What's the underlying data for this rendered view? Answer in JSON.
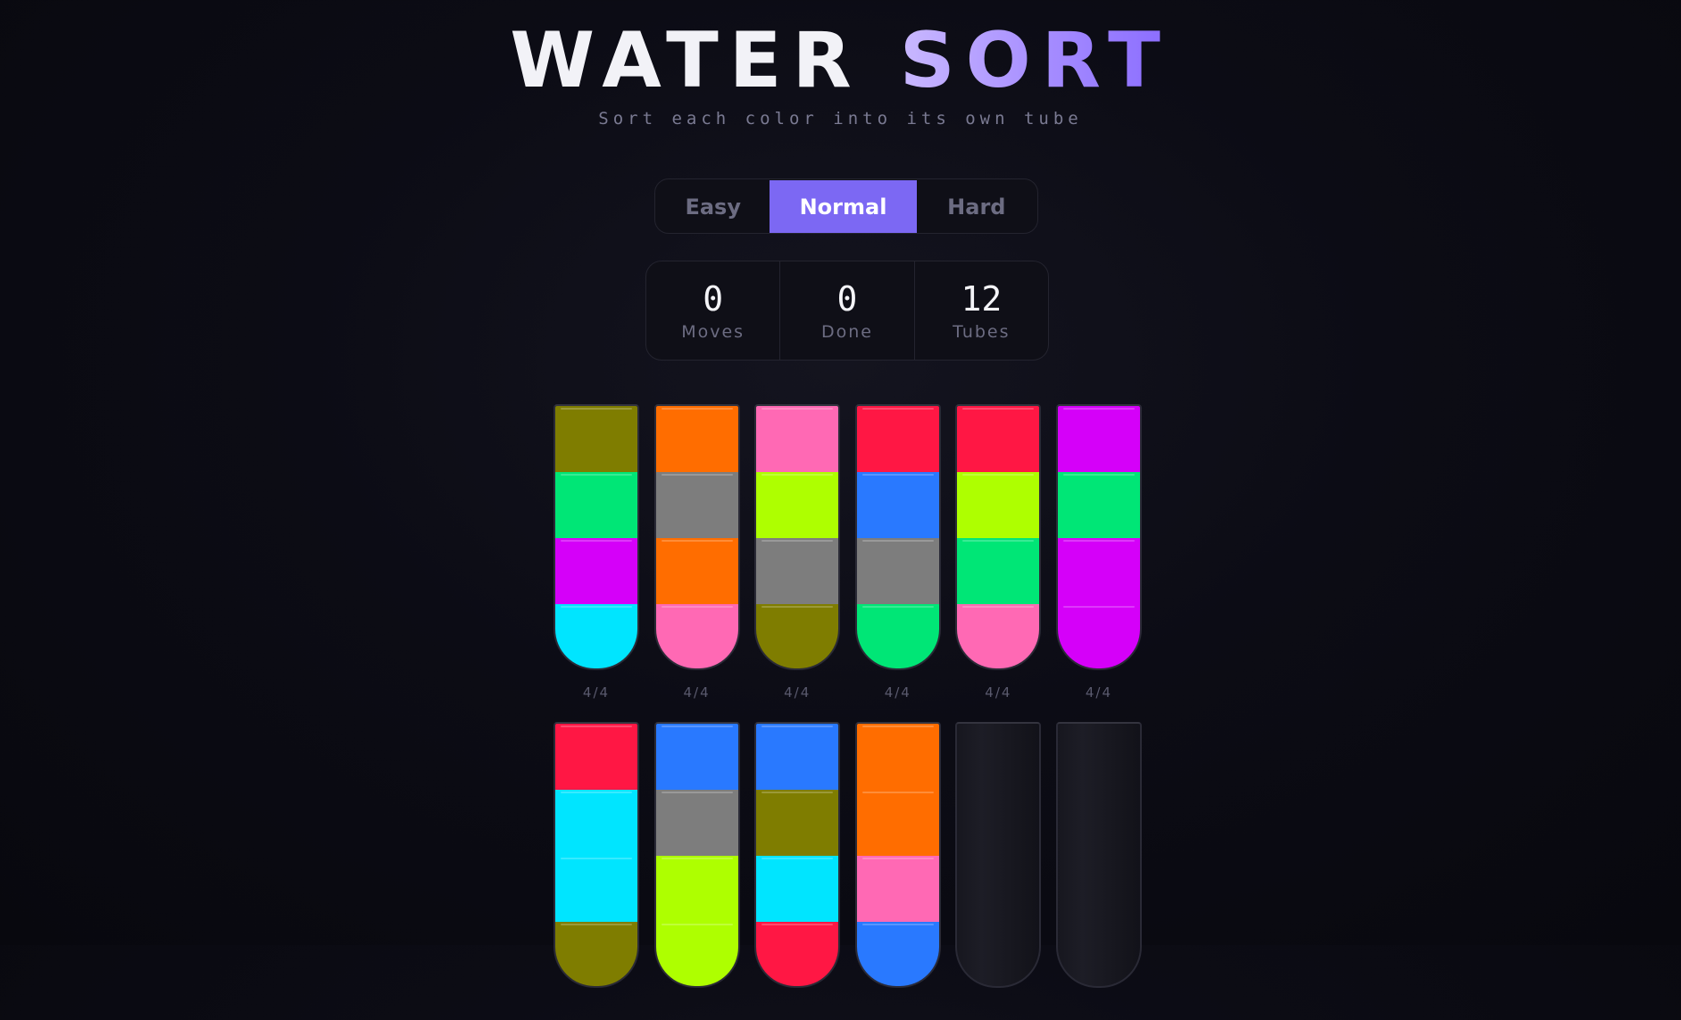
{
  "title": {
    "word1": "WATER",
    "word2": "SORT"
  },
  "subtitle": "Sort each color into its own tube",
  "difficulty": {
    "options": [
      "Easy",
      "Normal",
      "Hard"
    ],
    "selected": "Normal"
  },
  "stats": [
    {
      "value": "0",
      "label": "Moves"
    },
    {
      "value": "0",
      "label": "Done"
    },
    {
      "value": "12",
      "label": "Tubes"
    }
  ],
  "colors": {
    "olive": "#7f7d00",
    "green": "#00e676",
    "purple": "#d500f9",
    "cyan": "#00e5ff",
    "orange": "#ff6d00",
    "gray": "#7d7d7d",
    "pink": "#ff69b4",
    "lime": "#aeff00",
    "red": "#ff1744",
    "blue": "#2979ff"
  },
  "tubes": [
    {
      "layers": [
        "olive",
        "green",
        "purple",
        "cyan"
      ],
      "count": "4/4"
    },
    {
      "layers": [
        "orange",
        "gray",
        "orange",
        "pink"
      ],
      "count": "4/4"
    },
    {
      "layers": [
        "pink",
        "lime",
        "gray",
        "olive"
      ],
      "count": "4/4"
    },
    {
      "layers": [
        "red",
        "blue",
        "gray",
        "green"
      ],
      "count": "4/4"
    },
    {
      "layers": [
        "red",
        "lime",
        "green",
        "pink"
      ],
      "count": "4/4"
    },
    {
      "layers": [
        "purple",
        "green",
        "purple",
        "purple"
      ],
      "count": "4/4"
    },
    {
      "layers": [
        "red",
        "cyan",
        "cyan",
        "olive"
      ],
      "count": ""
    },
    {
      "layers": [
        "blue",
        "gray",
        "lime",
        "lime"
      ],
      "count": ""
    },
    {
      "layers": [
        "blue",
        "olive",
        "cyan",
        "red"
      ],
      "count": ""
    },
    {
      "layers": [
        "orange",
        "orange",
        "pink",
        "blue"
      ],
      "count": ""
    },
    {
      "layers": [],
      "count": ""
    },
    {
      "layers": [],
      "count": ""
    }
  ]
}
